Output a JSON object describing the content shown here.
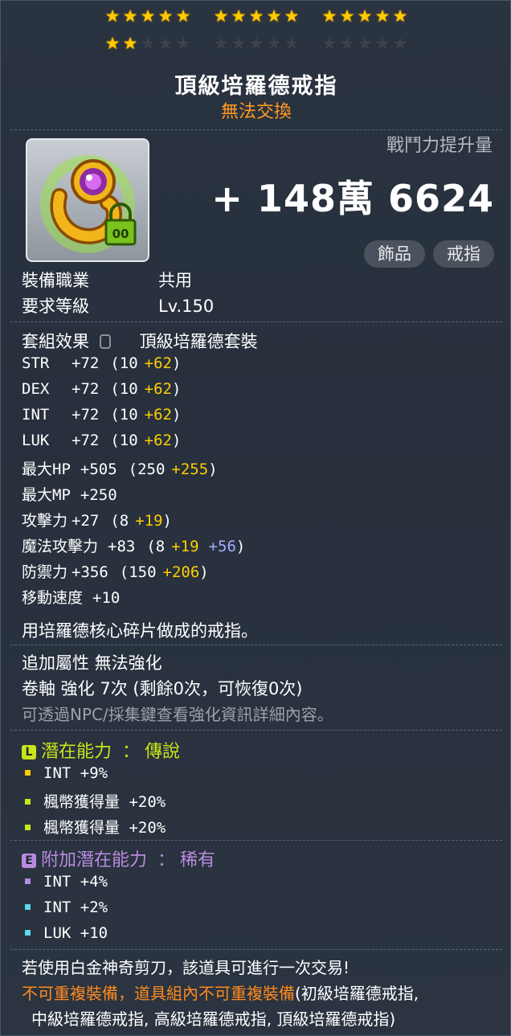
{
  "stars": {
    "total": 30,
    "filled": 17
  },
  "item": {
    "name": "頂級培羅德戒指",
    "trade_status": "無法交換",
    "icon": "golden-ring-with-purple-gem-and-green-lock-icon"
  },
  "power": {
    "label": "戰鬥力提升量",
    "value": "+ 148萬 6624"
  },
  "tags": [
    "飾品",
    "戒指"
  ],
  "info": {
    "job_label": "裝備職業",
    "job_value": "共用",
    "level_label": "要求等級",
    "level_value": "Lv.150",
    "set_label": "套組效果",
    "set_icon": "lock-icon",
    "set_value": "頂級培羅德套裝"
  },
  "stats": [
    {
      "name": "STR",
      "total": "+72",
      "open": "(10",
      "add1": "+62",
      "add2": "",
      "close": ")"
    },
    {
      "name": "DEX",
      "total": "+72",
      "open": "(10",
      "add1": "+62",
      "add2": "",
      "close": ")"
    },
    {
      "name": "INT",
      "total": "+72",
      "open": "(10",
      "add1": "+62",
      "add2": "",
      "close": ")"
    },
    {
      "name": "LUK",
      "total": "+72",
      "open": "(10",
      "add1": "+62",
      "add2": "",
      "close": ")"
    },
    {
      "name": "最大HP",
      "total": "+505",
      "open": "(250",
      "add1": "+255",
      "add2": "",
      "close": ")"
    },
    {
      "name": "最大MP",
      "total": "+250",
      "open": "",
      "add1": "",
      "add2": "",
      "close": ""
    },
    {
      "name": "攻擊力",
      "total": "+27",
      "open": "(8",
      "add1": "+19",
      "add2": "",
      "close": ")"
    },
    {
      "name": "魔法攻擊力",
      "total": "+83",
      "open": "(8",
      "add1": "+19",
      "add2": "+56",
      "close": ")"
    },
    {
      "name": "防禦力",
      "total": "+356",
      "open": "(150",
      "add1": "+206",
      "add2": "",
      "close": ")"
    },
    {
      "name": "移動速度",
      "total": "+10",
      "open": "",
      "add1": "",
      "add2": "",
      "close": ""
    }
  ],
  "description": "用培羅德核心碎片做成的戒指。",
  "extra_attr": "追加屬性 無法強化",
  "scroll": "卷軸 強化 7次 (剩餘0次，可恢復0次)",
  "hint": "可透過NPC/採集鍵查看強化資訊詳細內容。",
  "potential": {
    "label": "潛在能力",
    "sep": "：",
    "grade": "傳說",
    "badge": "L",
    "color": "#c7e51a",
    "lines": [
      {
        "text": "INT +9%",
        "dot_color": "#ffcc00"
      },
      {
        "text": "楓幣獲得量 +20%",
        "dot_color": "#c7e51a"
      },
      {
        "text": "楓幣獲得量 +20%",
        "dot_color": "#c7e51a"
      }
    ]
  },
  "additional_potential": {
    "label": "附加潛在能力",
    "sep": "：",
    "grade": "稀有",
    "badge": "E",
    "color": "#b98be0",
    "lines": [
      {
        "text": "INT +4%",
        "dot_color": "#b98be0"
      },
      {
        "text": "INT +2%",
        "dot_color": "#5fd8e8"
      },
      {
        "text": "LUK +10",
        "dot_color": "#5fd8e8"
      }
    ]
  },
  "footer": {
    "scissors": "若使用白金神奇剪刀，該道具可進行一次交易!",
    "unique_warning": "不可重複裝備，道具組內不可重複裝備",
    "unique_list_a": "(初級培羅德戒指,",
    "unique_list_b": "中級培羅德戒指, 高級培羅德戒指, 頂級培羅德戒指)"
  },
  "colors": {
    "title": "#ffffff",
    "untradeable": "#ff9a22",
    "bonus": "#ffcc00",
    "bonus_magic": "#aaaaff",
    "warning": "#ff8a1f"
  }
}
